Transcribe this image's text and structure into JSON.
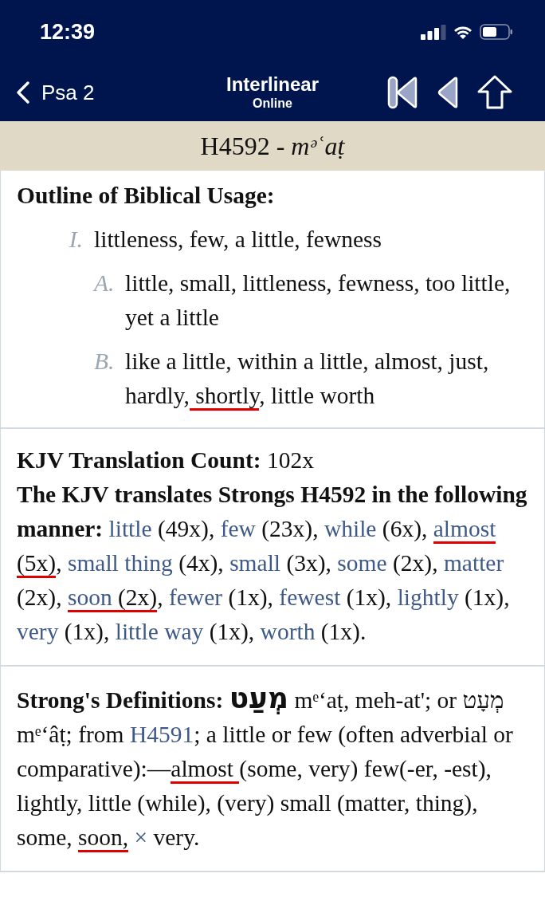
{
  "status_bar": {
    "time": "12:39"
  },
  "nav": {
    "back_label": "Psa 2",
    "title": "Interlinear",
    "subtitle": "Online"
  },
  "heading": "H4592 - *mᵊʿaṭ*",
  "outline": {
    "title": "Outline of Biblical Usage:",
    "items": [
      {
        "label": "I.",
        "segments": [
          {
            "text": "littleness, few, a little, fewness",
            "kind": "plain",
            "marked": false
          }
        ],
        "children": [
          {
            "label": "A.",
            "segments": [
              {
                "text": "little, small, littleness, fewness, too little, yet a little",
                "kind": "plain",
                "marked": false
              }
            ]
          },
          {
            "label": "B.",
            "segments": [
              {
                "text": "like a little, within a little, almost, just, hardly,",
                "kind": "plain",
                "marked": false
              },
              {
                "text": " shortly",
                "kind": "plain",
                "marked": true
              },
              {
                "text": ", little worth",
                "kind": "plain",
                "marked": false
              }
            ]
          }
        ]
      }
    ]
  },
  "kjv": {
    "count": "**KJV Translation Count:** 102x",
    "segments": [
      {
        "text": "The KJV translates Strongs H4592 in the following manner: ",
        "kind": "bold",
        "marked": false
      },
      {
        "text": "little",
        "kind": "link",
        "marked": false
      },
      {
        "text": " (49x), ",
        "kind": "plain",
        "marked": false
      },
      {
        "text": "few",
        "kind": "link",
        "marked": false
      },
      {
        "text": " (23x), ",
        "kind": "plain",
        "marked": false
      },
      {
        "text": "while",
        "kind": "link",
        "marked": false
      },
      {
        "text": " (6x), ",
        "kind": "plain",
        "marked": false
      },
      {
        "text": "almost",
        "kind": "link",
        "marked": true
      },
      {
        "text": " (5x)",
        "kind": "plain",
        "marked": true
      },
      {
        "text": ", ",
        "kind": "plain",
        "marked": false
      },
      {
        "text": "small thing",
        "kind": "link",
        "marked": false
      },
      {
        "text": " (4x), ",
        "kind": "plain",
        "marked": false
      },
      {
        "text": "small",
        "kind": "link",
        "marked": false
      },
      {
        "text": " (3x), ",
        "kind": "plain",
        "marked": false
      },
      {
        "text": "some",
        "kind": "link",
        "marked": false
      },
      {
        "text": " (2x), ",
        "kind": "plain",
        "marked": false
      },
      {
        "text": "matter",
        "kind": "link",
        "marked": false
      },
      {
        "text": " (2x), ",
        "kind": "plain",
        "marked": false
      },
      {
        "text": "soon",
        "kind": "link",
        "marked": true
      },
      {
        "text": " (2x)",
        "kind": "plain",
        "marked": true
      },
      {
        "text": ", ",
        "kind": "plain",
        "marked": false
      },
      {
        "text": "fewer",
        "kind": "link",
        "marked": false
      },
      {
        "text": " (1x), ",
        "kind": "plain",
        "marked": false
      },
      {
        "text": "fewest",
        "kind": "link",
        "marked": false
      },
      {
        "text": " (1x), ",
        "kind": "plain",
        "marked": false
      },
      {
        "text": "lightly",
        "kind": "link",
        "marked": false
      },
      {
        "text": " (1x), ",
        "kind": "plain",
        "marked": false
      },
      {
        "text": "very",
        "kind": "link",
        "marked": false
      },
      {
        "text": " (1x), ",
        "kind": "plain",
        "marked": false
      },
      {
        "text": "little way",
        "kind": "link",
        "marked": false
      },
      {
        "text": " (1x), ",
        "kind": "plain",
        "marked": false
      },
      {
        "text": "worth",
        "kind": "link",
        "marked": false
      },
      {
        "text": " (1x).",
        "kind": "plain",
        "marked": false
      }
    ]
  },
  "strongs": {
    "segments": [
      {
        "text": "Strong's Definitions: ",
        "kind": "bold",
        "marked": false
      },
      {
        "text": "מְעַט",
        "kind": "hebrew",
        "marked": false
      },
      {
        "text": " mᵉʻaṭ, meh-at'; or מְעָט mᵉʻâṭ; from ",
        "kind": "plain",
        "marked": false
      },
      {
        "text": "H4591",
        "kind": "link",
        "marked": false
      },
      {
        "text": "; a little or few (often adverbial or comparative):—",
        "kind": "plain",
        "marked": false
      },
      {
        "text": "almost ",
        "kind": "plain",
        "marked": true
      },
      {
        "text": "(some, very) few(-er, -est), lightly, little (while), (very) small (matter, thing), some, ",
        "kind": "plain",
        "marked": false
      },
      {
        "text": "soon,",
        "kind": "plain",
        "marked": true
      },
      {
        "text": " ×",
        "kind": "symbol",
        "marked": false
      },
      {
        "text": " very.",
        "kind": "plain",
        "marked": false
      }
    ]
  }
}
